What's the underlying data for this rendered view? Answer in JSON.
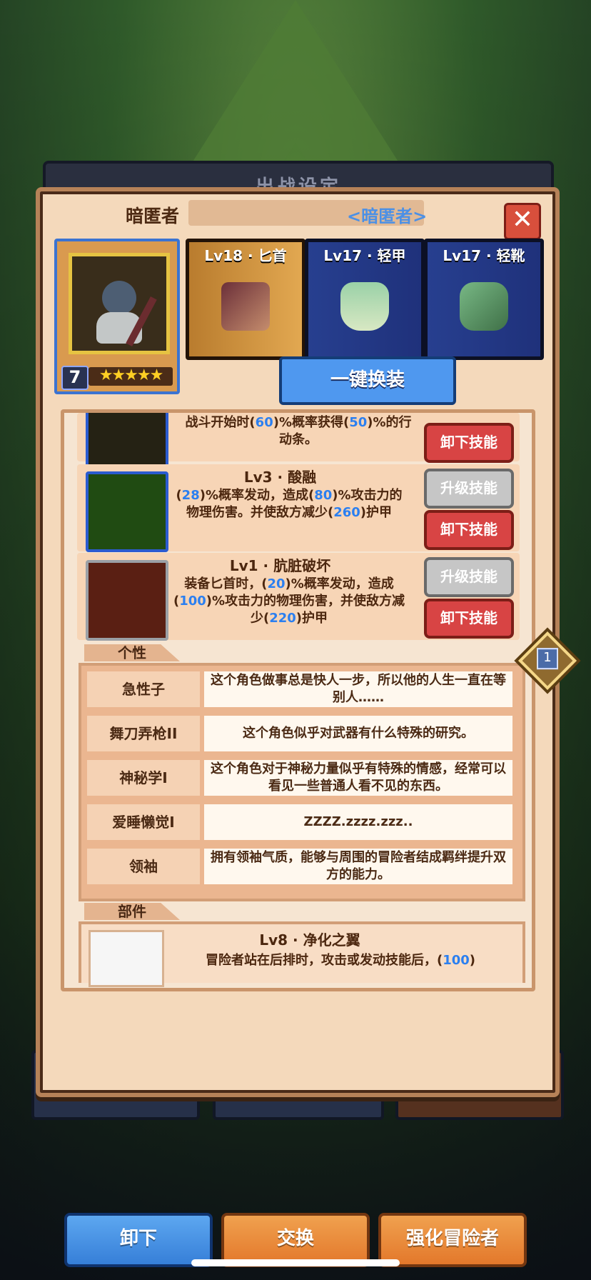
{
  "scene": {
    "back_panel_title": "出战设定",
    "home_indicator": ""
  },
  "modal": {
    "title": "暗匿者",
    "subtitle": "<暗匿者>",
    "close_icon": "✕",
    "character": {
      "level": "7",
      "stars": "★★★★★"
    },
    "equipment": [
      {
        "label": "Lv18 · 匕首",
        "icon": "dagger-icon"
      },
      {
        "label": "Lv17 · 轻甲",
        "icon": "light-armor-icon"
      },
      {
        "label": "Lv17 · 轻靴",
        "icon": "light-boots-icon"
      }
    ],
    "equip_all_button": "一键换装",
    "skills": {
      "top_partial": {
        "desc_1": "战斗开始时(",
        "desc_num_1": "60",
        "desc_2": ")%概率获得(",
        "desc_num_2": "50",
        "desc_3": ")%的行",
        "desc_4": "动条。",
        "unequip_button": "卸下技能"
      },
      "items": [
        {
          "name": "Lv3 · 酸融",
          "desc_a": "(",
          "num_a": "28",
          "desc_b": ")%概率发动，造成(",
          "num_b": "80",
          "desc_c": ")%攻击力的",
          "desc_d": "物理伤害。并使敌方减少(",
          "num_d": "260",
          "desc_e": ")护甲",
          "upgrade_button": "升级技能",
          "unequip_button": "卸下技能"
        },
        {
          "name": "Lv1 · 肮脏破坏",
          "desc_a": "装备匕首时，(",
          "num_a": "20",
          "desc_b": ")%概率发动，造成(",
          "num_b": "100",
          "desc_c": ")%攻击力的物理伤害，并使敌方减",
          "desc_d": "少(",
          "num_d": "220",
          "desc_e": ")护甲",
          "upgrade_button": "升级技能",
          "unequip_button": "卸下技能"
        }
      ]
    },
    "traits_section_label": "个性",
    "traits": [
      {
        "name": "急性子",
        "desc": "这个角色做事总是快人一步，所以他的人生一直在等别人……"
      },
      {
        "name": "舞刀弄枪II",
        "desc": "这个角色似乎对武器有什么特殊的研究。"
      },
      {
        "name": "神秘学I",
        "desc": "这个角色对于神秘力量似乎有特殊的情感，经常可以看见一些普通人看不见的东西。"
      },
      {
        "name": "爱睡懒觉I",
        "desc": "ZZZZ.zzzz.zzz.."
      },
      {
        "name": "领袖",
        "desc": "拥有领袖气质，能够与周围的冒险者结成羁绊提升双方的能力。"
      }
    ],
    "parts_section_label": "部件",
    "part": {
      "title": "Lv8 · 净化之翼",
      "desc_prefix": "冒险者站在后排时，攻击或发动技能后，(",
      "desc_num": "100",
      "desc_suffix": ")"
    },
    "footer_buttons": {
      "unequip": "卸下",
      "swap": "交换",
      "upgrade": "强化冒险者"
    },
    "side_badge": "1"
  }
}
